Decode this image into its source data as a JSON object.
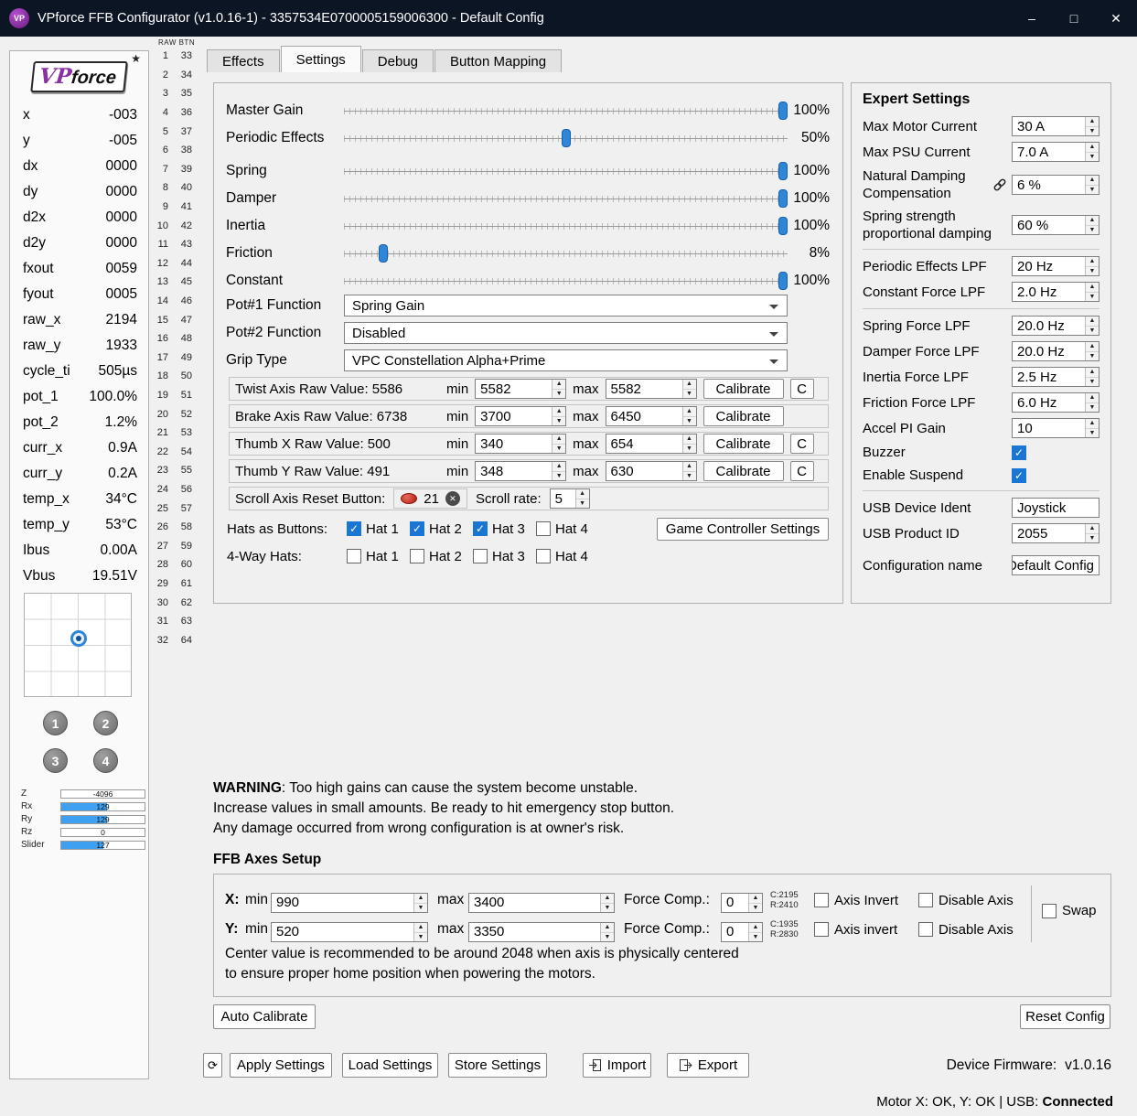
{
  "colors": {
    "titlebar": "#0b1524",
    "accent": "#2f86d8",
    "check": "#1976d2",
    "barfill": "#3da0f0",
    "red": "#b11c10"
  },
  "window": {
    "icon_text": "VP",
    "title": "VPforce FFB Configurator (v1.0.16-1) - 3357534E0700005159006300 - Default Config",
    "minimize": "–",
    "maximize": "□",
    "close": "✕"
  },
  "sidebar": {
    "logo": {
      "vp": "VP",
      "force": "force",
      "star": "★"
    },
    "telemetry": [
      {
        "label": "x",
        "value": "-003"
      },
      {
        "label": "y",
        "value": "-005"
      },
      {
        "label": "dx",
        "value": "0000"
      },
      {
        "label": "dy",
        "value": "0000"
      },
      {
        "label": "d2x",
        "value": "0000"
      },
      {
        "label": "d2y",
        "value": "0000"
      },
      {
        "label": "fxout",
        "value": "0059"
      },
      {
        "label": "fyout",
        "value": "0005"
      },
      {
        "label": "raw_x",
        "value": "2194"
      },
      {
        "label": "raw_y",
        "value": "1933"
      },
      {
        "label": "cycle_ti",
        "value": "505µs"
      },
      {
        "label": "pot_1",
        "value": "100.0%"
      },
      {
        "label": "pot_2",
        "value": "1.2%"
      },
      {
        "label": "curr_x",
        "value": "0.9A"
      },
      {
        "label": "curr_y",
        "value": "0.2A"
      },
      {
        "label": "temp_x",
        "value": "34°C"
      },
      {
        "label": "temp_y",
        "value": "53°C"
      },
      {
        "label": "Ibus",
        "value": "0.00A"
      },
      {
        "label": "Vbus",
        "value": "19.51V"
      }
    ],
    "preset_buttons": [
      "1",
      "2",
      "3",
      "4"
    ],
    "axis_bars": [
      {
        "label": "Z",
        "value": "-4096",
        "pct": 0
      },
      {
        "label": "Rx",
        "value": "129",
        "pct": 55
      },
      {
        "label": "Ry",
        "value": "129",
        "pct": 55
      },
      {
        "label": "Rz",
        "value": "0",
        "pct": 0
      },
      {
        "label": "Slider",
        "value": "127",
        "pct": 50
      }
    ]
  },
  "raw_btn": {
    "header": "RAW BTN",
    "rows": 32,
    "col1_start": 1,
    "col2_start": 33
  },
  "tabs": [
    {
      "label": "Effects",
      "active": false
    },
    {
      "label": "Settings",
      "active": true
    },
    {
      "label": "Debug",
      "active": false
    },
    {
      "label": "Button Mapping",
      "active": false
    }
  ],
  "settings": {
    "sliders": [
      {
        "label": "Master Gain",
        "value": "100%",
        "pct": 100
      },
      {
        "label": "Periodic Effects",
        "value": "50%",
        "pct": 50
      },
      {
        "label": "Spring",
        "value": "100%",
        "pct": 100
      },
      {
        "label": "Damper",
        "value": "100%",
        "pct": 100
      },
      {
        "label": "Inertia",
        "value": "100%",
        "pct": 100
      },
      {
        "label": "Friction",
        "value": "8%",
        "pct": 8
      },
      {
        "label": "Constant",
        "value": "100%",
        "pct": 100
      }
    ],
    "dropdowns": [
      {
        "label": "Pot#1 Function",
        "value": "Spring Gain"
      },
      {
        "label": "Pot#2 Function",
        "value": "Disabled"
      },
      {
        "label": "Grip Type",
        "value": "VPC Constellation Alpha+Prime"
      }
    ],
    "min_label": "min",
    "max_label": "max",
    "axes": [
      {
        "name": "Twist Axis",
        "label": "Twist Axis Raw Value: 5586",
        "min": "5582",
        "max": "5582",
        "calibrate": "Calibrate",
        "c": "C",
        "has_c": true
      },
      {
        "name": "Brake Axis",
        "label": "Brake Axis Raw Value: 6738",
        "min": "3700",
        "max": "6450",
        "calibrate": "Calibrate",
        "c": "",
        "has_c": false
      },
      {
        "name": "Thumb X",
        "label": "Thumb X  Raw Value: 500",
        "min": "340",
        "max": "654",
        "calibrate": "Calibrate",
        "c": "C",
        "has_c": true
      },
      {
        "name": "Thumb Y",
        "label": "Thumb Y  Raw Value: 491",
        "min": "348",
        "max": "630",
        "calibrate": "Calibrate",
        "c": "C",
        "has_c": true
      }
    ],
    "scroll": {
      "label": "Scroll Axis Reset Button:",
      "button": "21",
      "clear": "✕",
      "rate_label": "Scroll rate:",
      "rate": "5"
    },
    "hats_buttons": {
      "label": "Hats as Buttons:",
      "items": [
        {
          "label": "Hat 1",
          "checked": true
        },
        {
          "label": "Hat 2",
          "checked": true
        },
        {
          "label": "Hat 3",
          "checked": true
        },
        {
          "label": "Hat 4",
          "checked": false
        }
      ]
    },
    "four_way": {
      "label": "4-Way Hats:",
      "items": [
        {
          "label": "Hat 1",
          "checked": false
        },
        {
          "label": "Hat 2",
          "checked": false
        },
        {
          "label": "Hat 3",
          "checked": false
        },
        {
          "label": "Hat 4",
          "checked": false
        }
      ]
    },
    "game_controller_button": "Game Controller Settings"
  },
  "expert": {
    "title": "Expert Settings",
    "rows": [
      {
        "type": "spin",
        "label": "Max Motor Current",
        "value": "30 A"
      },
      {
        "type": "spin",
        "label": "Max PSU Current",
        "value": "7.0 A"
      },
      {
        "type": "spin",
        "label": "Natural Damping Compensation",
        "value": "6 %",
        "two_line": true,
        "link_icon": true
      },
      {
        "type": "spin",
        "label": "Spring strength proportional damping",
        "value": "60 %",
        "two_line": true
      },
      {
        "type": "sep"
      },
      {
        "type": "spin",
        "label": "Periodic Effects LPF",
        "value": "20 Hz"
      },
      {
        "type": "spin",
        "label": "Constant Force LPF",
        "value": "2.0 Hz"
      },
      {
        "type": "sep"
      },
      {
        "type": "spin",
        "label": "Spring Force LPF",
        "value": "20.0 Hz"
      },
      {
        "type": "spin",
        "label": "Damper Force LPF",
        "value": "20.0 Hz"
      },
      {
        "type": "spin",
        "label": "Inertia Force LPF",
        "value": "2.5 Hz"
      },
      {
        "type": "spin",
        "label": "Friction Force LPF",
        "value": "6.0 Hz"
      },
      {
        "type": "spin",
        "label": "Accel PI Gain",
        "value": "10"
      },
      {
        "type": "check",
        "label": "Buzzer",
        "checked": true
      },
      {
        "type": "check",
        "label": "Enable Suspend",
        "checked": true
      },
      {
        "type": "sep"
      },
      {
        "type": "text",
        "label": "USB Device Ident",
        "value": "Joystick"
      },
      {
        "type": "spin",
        "label": "USB Product ID",
        "value": "2055"
      },
      {
        "type": "text",
        "label": "Configuration name",
        "value": "Default Config",
        "clip": true,
        "extra_margin": true
      }
    ]
  },
  "warning": {
    "bold": "WARNING",
    "line1": ": Too high gains can cause the system become unstable.",
    "line2": "Increase values in small amounts. Be ready to hit emergency stop button.",
    "line3": "Any damage occurred from wrong configuration is at owner's risk."
  },
  "ffb_axes": {
    "title": "FFB Axes Setup",
    "rows": [
      {
        "axis": "X:",
        "min_label": "min",
        "min": "990",
        "max_label": "max",
        "max": "3400",
        "fc_label": "Force Comp.:",
        "fc": "0",
        "c": "C:2195",
        "r": "R:2410",
        "invert_label": "Axis Invert",
        "invert_checked": false,
        "disable_label": "Disable Axis",
        "disable_checked": false
      },
      {
        "axis": "Y:",
        "min_label": "min",
        "min": "520",
        "max_label": "max",
        "max": "3350",
        "fc_label": "Force Comp.:",
        "fc": "0",
        "c": "C:1935",
        "r": "R:2830",
        "invert_label": "Axis invert",
        "invert_checked": false,
        "disable_label": "Disable Axis",
        "disable_checked": false
      }
    ],
    "swap_label": "Swap",
    "swap_checked": false,
    "note1": "Center value is recommended to be around 2048 when axis is physically centered",
    "note2": "to ensure proper home position when powering the motors."
  },
  "actions": {
    "auto_calibrate": "Auto Calibrate",
    "reset_config": "Reset Config",
    "refresh_icon": "⟳",
    "apply": "Apply Settings",
    "load": "Load Settings",
    "store": "Store Settings",
    "import": "Import",
    "export": "Export",
    "firmware_label": "Device Firmware:",
    "firmware_value": "v1.0.16"
  },
  "statusbar": {
    "prefix": "Motor X: OK, Y: OK | USB: ",
    "bold": "Connected"
  }
}
